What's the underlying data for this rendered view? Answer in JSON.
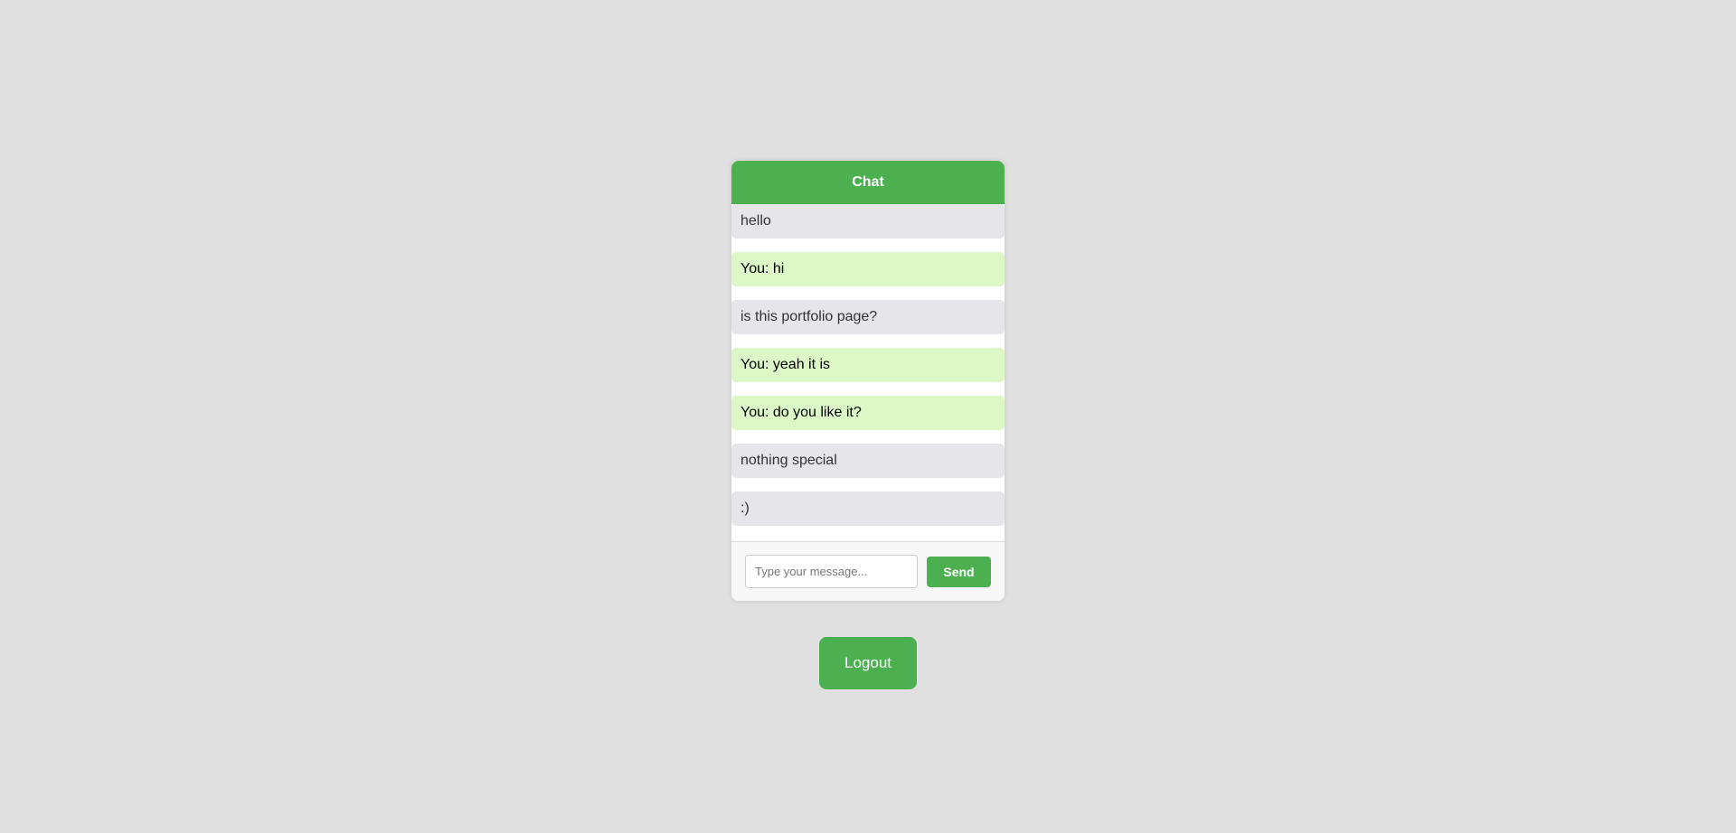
{
  "chat": {
    "title": "Chat",
    "messages": [
      {
        "text": "hello",
        "from": "other"
      },
      {
        "text": "You: hi",
        "from": "me"
      },
      {
        "text": "is this portfolio page?",
        "from": "other"
      },
      {
        "text": "You: yeah it is",
        "from": "me"
      },
      {
        "text": "You: do you like it?",
        "from": "me"
      },
      {
        "text": "nothing special",
        "from": "other"
      },
      {
        "text": ":)",
        "from": "other"
      }
    ],
    "input": {
      "value": "",
      "placeholder": "Type your message..."
    },
    "send_label": "Send"
  },
  "logout_label": "Logout",
  "colors": {
    "accent": "#4caf50",
    "sent_bubble": "#dcf8c6",
    "received_bubble": "#e6e6ea",
    "background": "#e0e0e0"
  }
}
